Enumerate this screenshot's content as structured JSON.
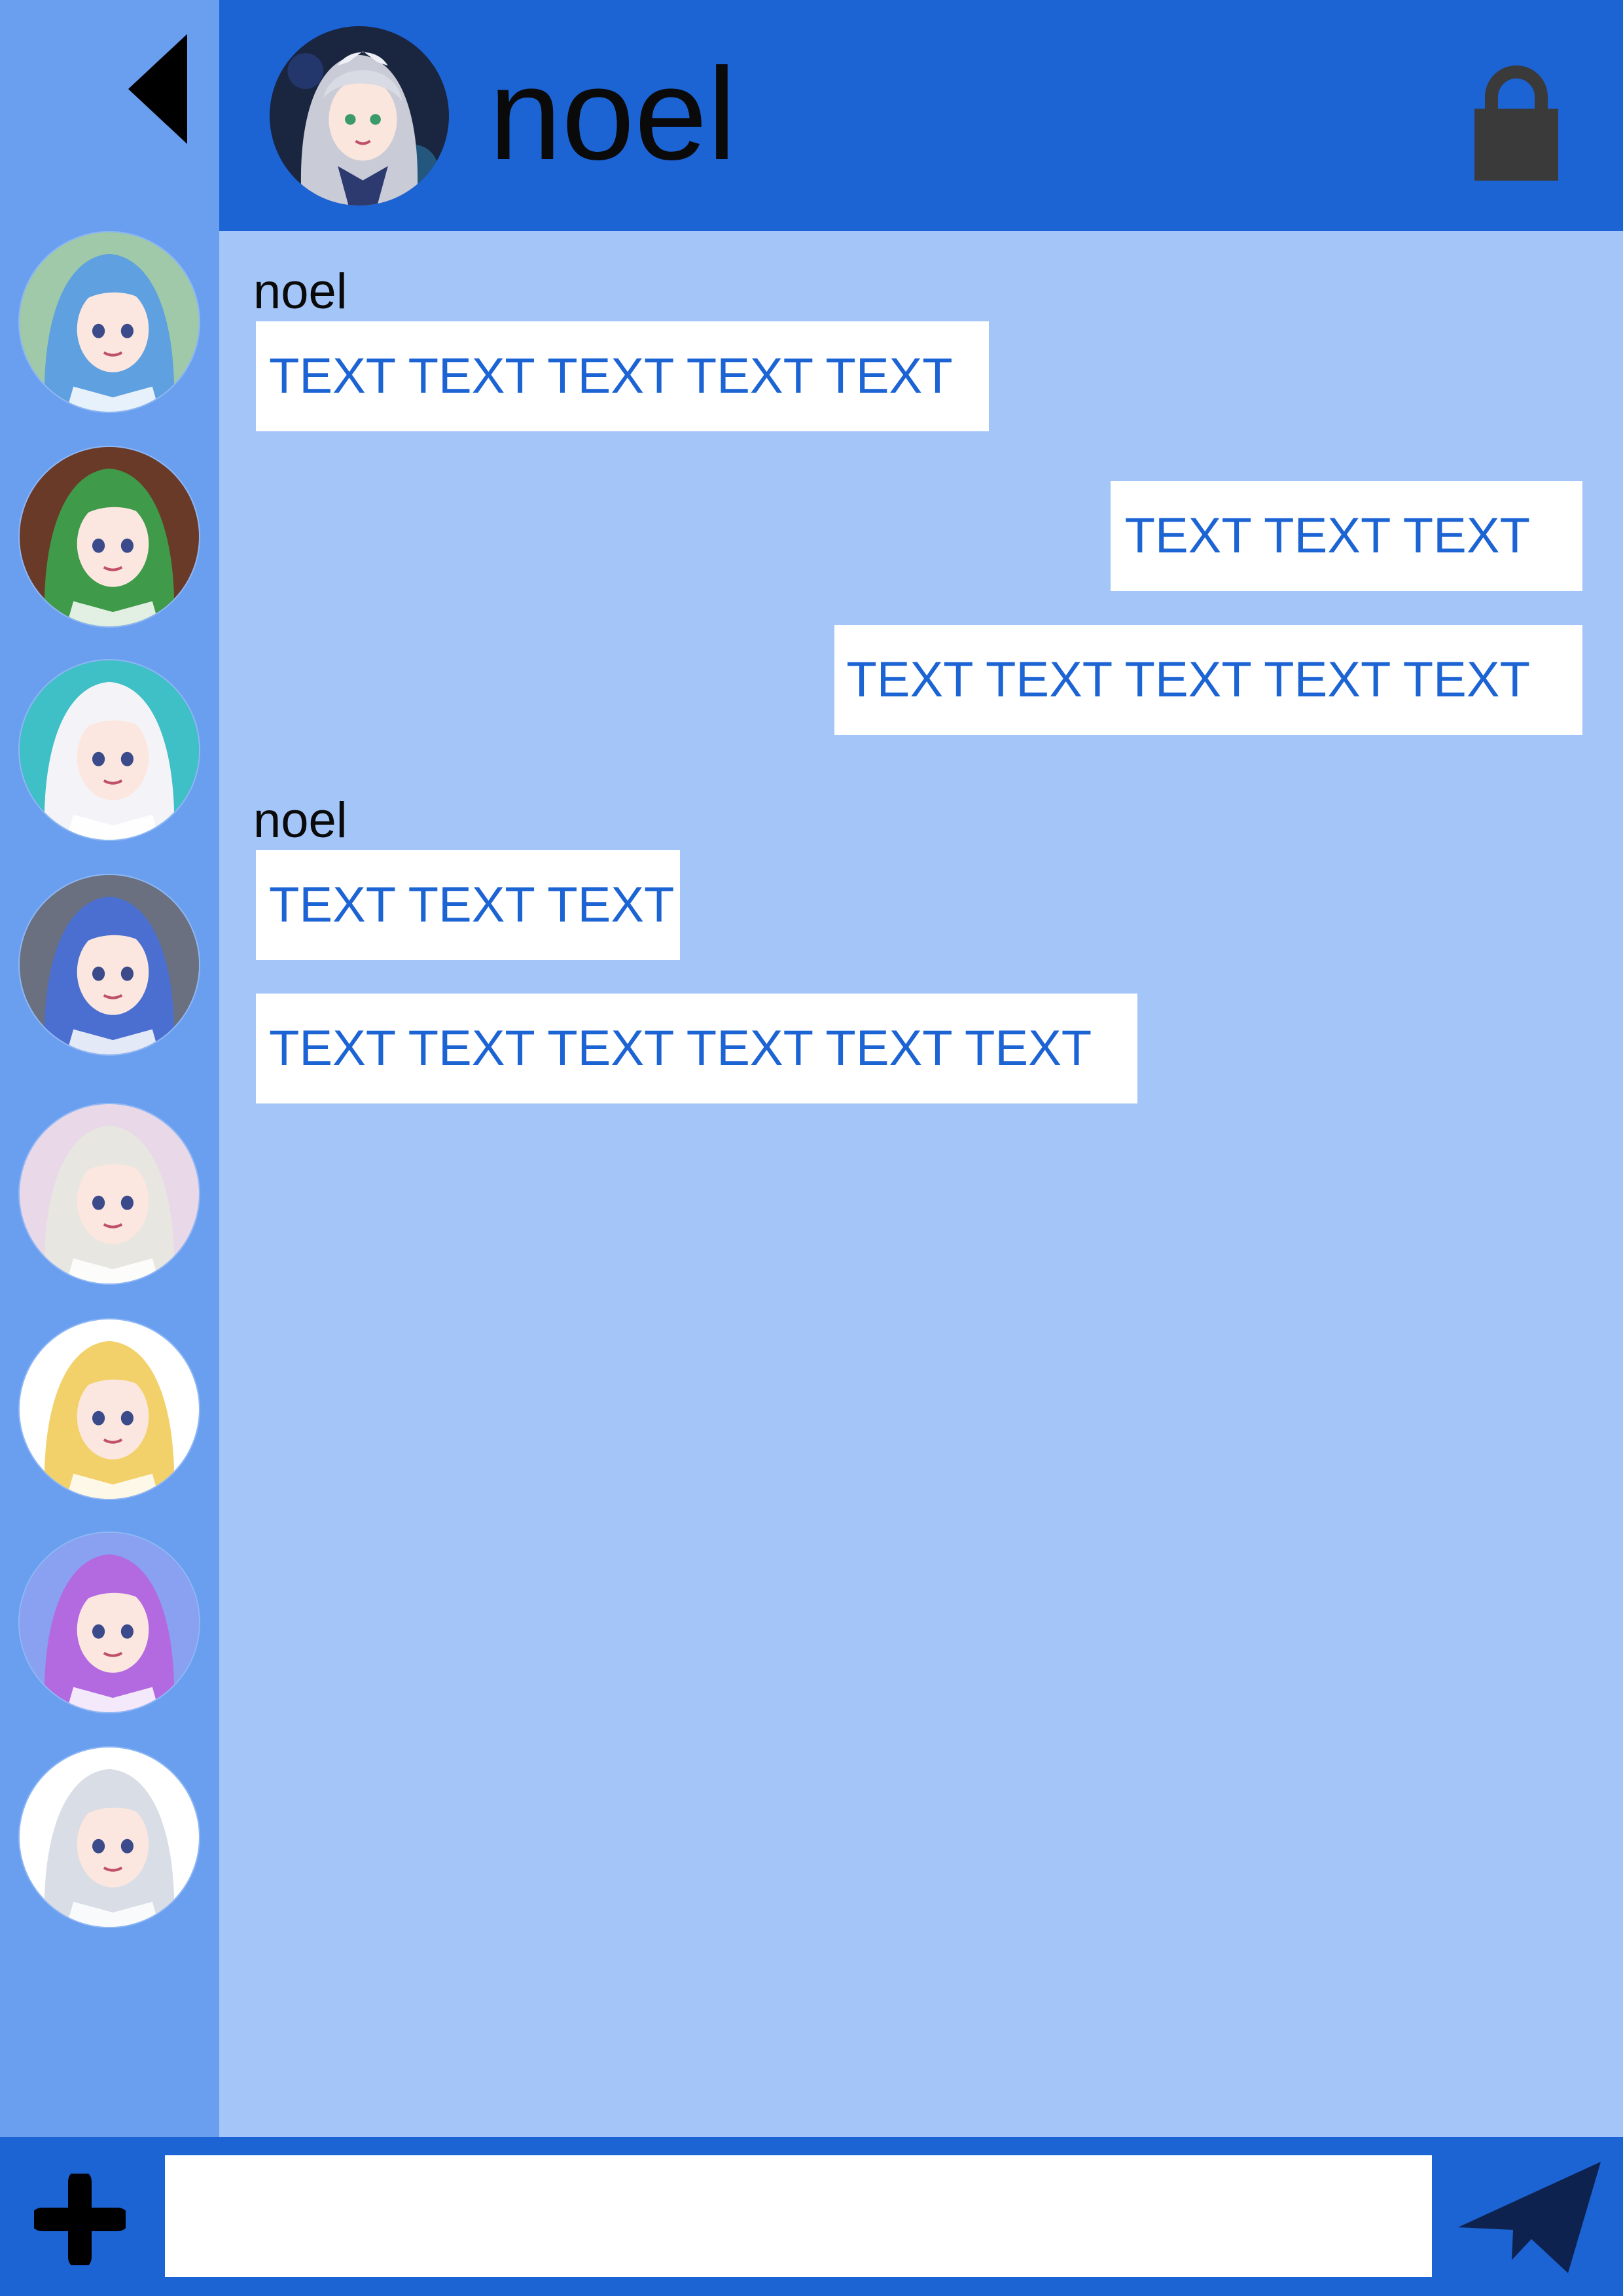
{
  "colors": {
    "header_bg": "#1c63d4",
    "sidebar_bg": "#6a9ff0",
    "chat_bg": "#a3c5f8",
    "bubble_bg": "#ffffff",
    "bubble_text": "#1c63d4",
    "icon_dark": "#3a3a3a",
    "send_icon": "#0e2250"
  },
  "header": {
    "title": "noel",
    "back_icon": "back-triangle-icon",
    "lock_icon": "lock-icon"
  },
  "sidebar": {
    "contacts": [
      {
        "hair": "#5ea0e0",
        "bg": "#9fc9a8"
      },
      {
        "hair": "#3f9a4a",
        "bg": "#6a3a28"
      },
      {
        "hair": "#f4f4f8",
        "bg": "#3fbfc6"
      },
      {
        "hair": "#4a6fd0",
        "bg": "#6a7080"
      },
      {
        "hair": "#e8e6e0",
        "bg": "#e8d8e8"
      },
      {
        "hair": "#f3d16a",
        "bg": "#ffffff"
      },
      {
        "hair": "#b36ae0",
        "bg": "#8aa0f0"
      },
      {
        "hair": "#d8dde6",
        "bg": "#ffffff"
      }
    ]
  },
  "messages": [
    {
      "direction": "in",
      "sender": "noel",
      "text": "TEXT TEXT TEXT TEXT TEXT"
    },
    {
      "direction": "out",
      "sender": "",
      "text": "TEXT TEXT TEXT"
    },
    {
      "direction": "out",
      "sender": "",
      "text": "TEXT TEXT TEXT TEXT TEXT"
    },
    {
      "direction": "in",
      "sender": "noel",
      "text": "TEXT TEXT TEXT"
    },
    {
      "direction": "in",
      "sender": "",
      "text": "TEXT TEXT TEXT TEXT TEXT TEXT"
    }
  ],
  "composer": {
    "value": "",
    "placeholder": "",
    "add_icon": "plus-icon",
    "send_icon": "send-paper-plane-icon"
  }
}
